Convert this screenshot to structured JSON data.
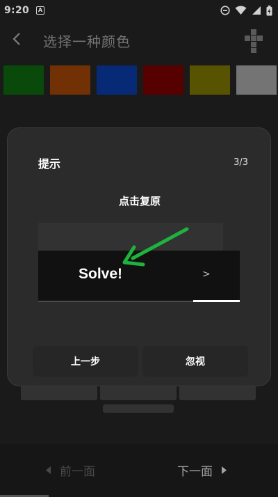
{
  "status_bar": {
    "time": "9:20",
    "notification_badge": "A",
    "icons": [
      "do-not-disturb-icon",
      "wifi-icon",
      "signal-icon",
      "battery-icon"
    ]
  },
  "title_bar": {
    "title": "选择一种颜色",
    "back_icon": "chevron-left-icon",
    "action_icon": "cube-icon"
  },
  "swatches": [
    {
      "name": "green",
      "color": "#0b5a0b"
    },
    {
      "name": "orange",
      "color": "#8a3c06"
    },
    {
      "name": "blue",
      "color": "#08348f"
    },
    {
      "name": "red",
      "color": "#6a0000"
    },
    {
      "name": "yellow",
      "color": "#6c6600"
    },
    {
      "name": "white",
      "color": "#8e8e8e"
    }
  ],
  "dialog": {
    "title": "提示",
    "step_counter": "3/3",
    "message": "点击复原",
    "demo_button_label": "Solve!",
    "demo_button_arrow": ">",
    "prev_button": "上一步",
    "ignore_button": "忽视",
    "arrow_color": "#1db33d"
  },
  "bottom_nav": {
    "prev_label": "前一面",
    "next_label": "下一面"
  }
}
